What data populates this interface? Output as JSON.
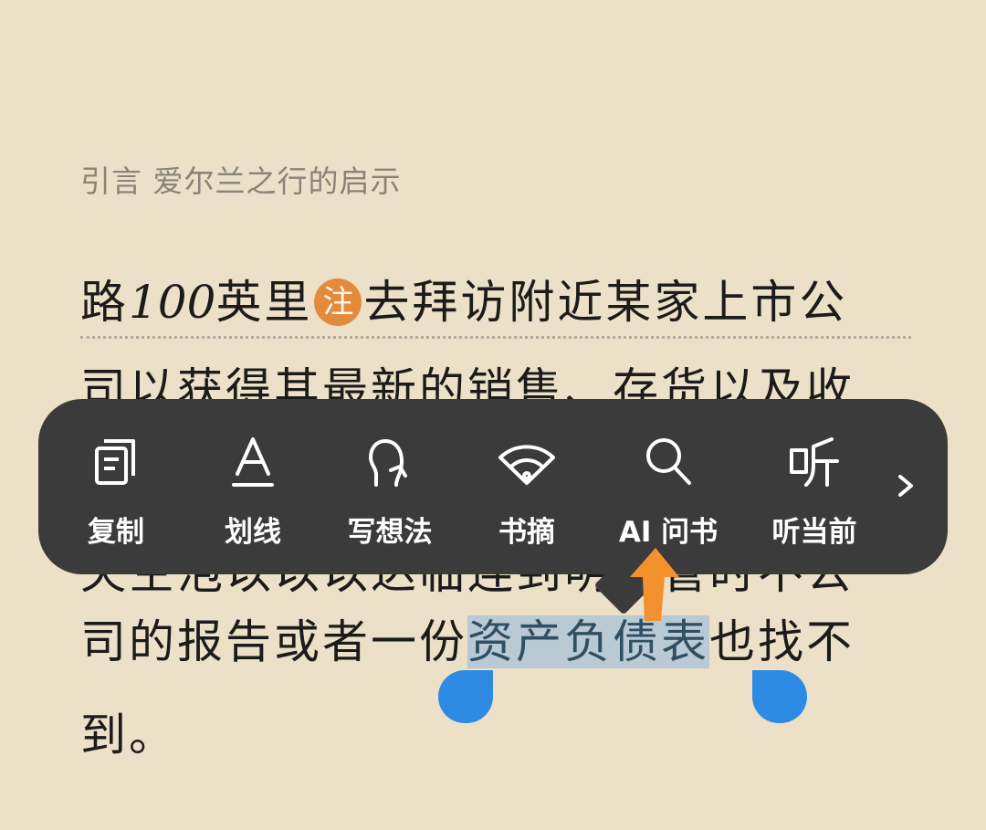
{
  "chapter_title": "引言 爱尔兰之行的启示",
  "book_text": {
    "line1": {
      "before": "路",
      "number": "100",
      "after": "英里",
      "note_mark": "注",
      "rest": "去拜访附近某家上市公"
    },
    "line2": "司以获得其最新的销售、存货以及收",
    "line3": "失空泡以以以达临连到明年管时不公",
    "line4": {
      "before": "司的报告或者一份",
      "selected": "资产负债表",
      "after": "也找不"
    },
    "line5": "到。"
  },
  "menu": {
    "items": [
      {
        "label": "复制",
        "icon": "copy-icon"
      },
      {
        "label": "划线",
        "icon": "underline-icon"
      },
      {
        "label": "写想法",
        "icon": "thought-icon"
      },
      {
        "label": "书摘",
        "icon": "fan-icon"
      },
      {
        "label": "AI 问书",
        "icon": "search-icon"
      },
      {
        "label": "听当前",
        "icon": "listen-icon"
      }
    ],
    "more_icon": "chevron-right-icon"
  },
  "colors": {
    "page_background": "#ede0c8",
    "menu_background": "#3b3b3b",
    "selection": "#b9cad4",
    "handle": "#2d8be4",
    "note_badge": "#e48a3c",
    "pointer_arrow": "#f4912f"
  }
}
